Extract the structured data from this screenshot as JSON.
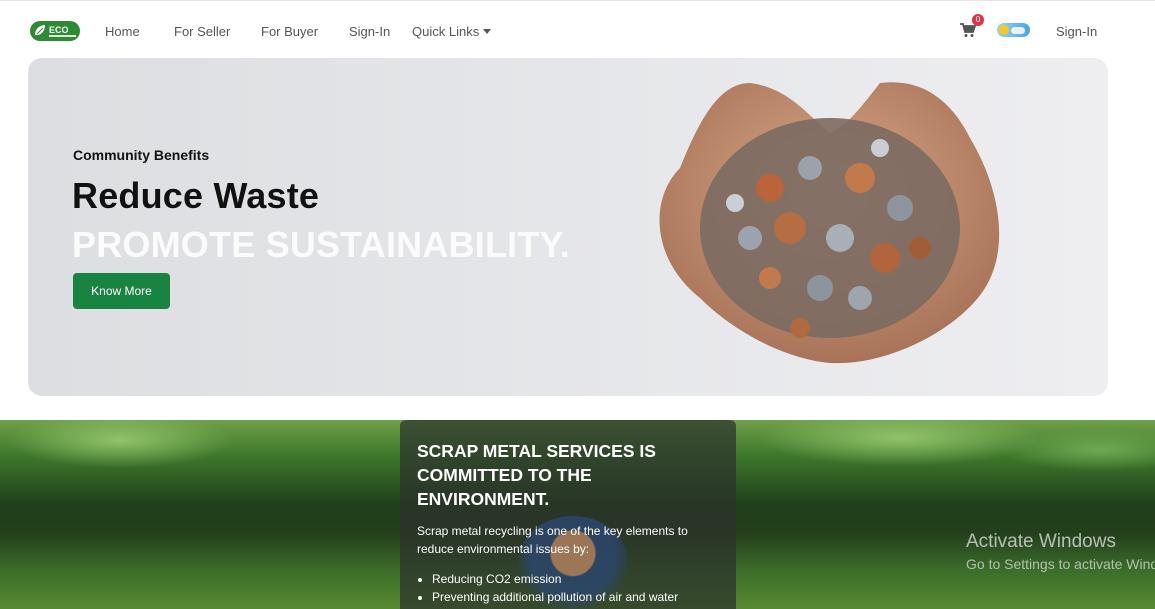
{
  "navbar": {
    "logo_text": "ECO",
    "links": [
      "Home",
      "For Seller",
      "For Buyer",
      "Sign-In"
    ],
    "quick_links_label": "Quick Links",
    "cart_count": "0",
    "right_signin_label": "Sign-In"
  },
  "hero": {
    "subtitle": "Community Benefits",
    "title": "Reduce Waste",
    "title_highlight": "PROMOTE SUSTAINABILITY.",
    "button_label": "Know More"
  },
  "services": {
    "title": "SCRAP METAL SERVICES IS COMMITTED TO THE ENVIRONMENT.",
    "text": "Scrap metal recycling is one of the key elements to reduce environmental issues by:",
    "items": [
      "Reducing CO2 emission",
      "Preventing additional pollution of air and water"
    ]
  },
  "watermark": {
    "title": "Activate Windows",
    "subtitle": "Go to Settings to activate Windows."
  },
  "colors": {
    "accent_green": "#198342",
    "badge_red": "#dc3545"
  },
  "icons": [
    "leaf-logo-icon",
    "cart-icon",
    "chevron-down-icon",
    "sun-icon",
    "cloud-icon"
  ]
}
